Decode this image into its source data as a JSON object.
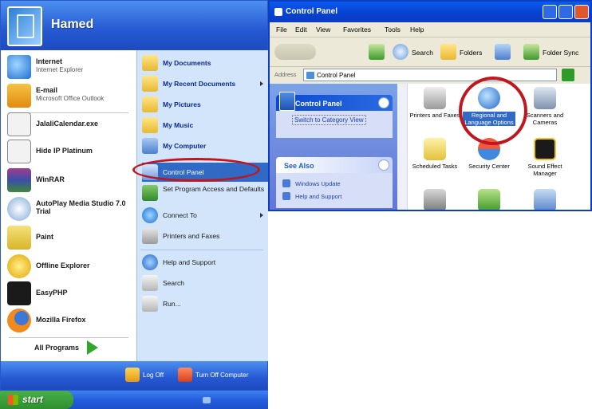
{
  "start_menu": {
    "username": "Hamed",
    "pinned": [
      {
        "title": "Internet",
        "subtitle": "Internet Explorer"
      },
      {
        "title": "E-mail",
        "subtitle": "Microsoft Office Outlook"
      }
    ],
    "recent": [
      "JalaliCalendar.exe",
      "Hide IP Platinum",
      "WinRAR",
      "AutoPlay Media Studio 7.0 Trial",
      "Paint",
      "Offline Explorer",
      "EasyPHP",
      "Mozilla Firefox"
    ],
    "all_programs": "All Programs",
    "right": [
      "My Documents",
      "My Recent Documents",
      "My Pictures",
      "My Music",
      "My Computer",
      "Control Panel",
      "Set Program Access and Defaults",
      "Connect To",
      "Printers and Faxes",
      "Help and Support",
      "Search",
      "Run..."
    ],
    "footer": {
      "log_off": "Log Off",
      "turn_off": "Turn Off Computer"
    }
  },
  "taskbar": {
    "start_label": "start"
  },
  "control_panel": {
    "title": "Control Panel",
    "menu": [
      "File",
      "Edit",
      "View",
      "Favorites",
      "Tools",
      "Help"
    ],
    "toolbar": {
      "search": "Search",
      "folders": "Folders",
      "folder_sync": "Folder Sync"
    },
    "address": {
      "label": "Address",
      "value": "Control Panel",
      "go": "Go"
    },
    "task_pane": {
      "header": "Control Panel",
      "switch_view": "Switch to Category View",
      "see_also": "See Also",
      "links": [
        "Windows Update",
        "Help and Support"
      ]
    },
    "items": [
      "Printers and Faxes",
      "Regional and Language Options",
      "Scanners and Cameras",
      "Scheduled Tasks",
      "Security Center",
      "Sound Effect Manager"
    ]
  },
  "colors": {
    "highlight": "#316ac5",
    "annotation": "#c0161f",
    "xp_blue": "#2558d2",
    "start_green": "#2f8f2f"
  }
}
